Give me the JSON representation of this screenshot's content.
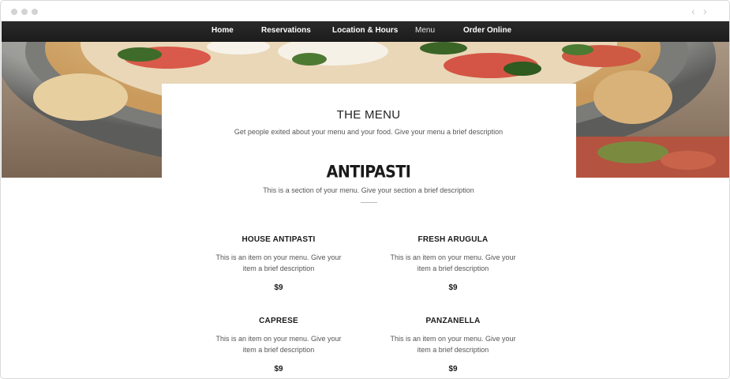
{
  "nav": {
    "items": [
      {
        "label": "Home"
      },
      {
        "label": "Reservations"
      },
      {
        "label": "Location & Hours"
      },
      {
        "label": "Menu"
      },
      {
        "label": "Order Online"
      }
    ],
    "active_index": 3
  },
  "hero": {
    "image": "pizza-photo"
  },
  "menu": {
    "title": "THE MENU",
    "description": "Get people exited about your menu and your food. Give your menu a brief description"
  },
  "section": {
    "title": "ANTIPASTI",
    "description": "This is a section of your menu. Give your section a brief description",
    "items": [
      {
        "name": "HOUSE ANTIPASTI",
        "description": "This is an item on your menu. Give your item a brief description",
        "price": "$9"
      },
      {
        "name": "FRESH ARUGULA",
        "description": "This is an item on your menu. Give your item a brief description",
        "price": "$9"
      },
      {
        "name": "CAPRESE",
        "description": "This is an item on your menu. Give your item a brief description",
        "price": "$9"
      },
      {
        "name": "PANZANELLA",
        "description": "This is an item on your menu. Give your item a brief description",
        "price": "$9"
      }
    ]
  },
  "browser": {
    "back_icon": "chevron-left-icon",
    "forward_icon": "chevron-right-icon"
  },
  "colors": {
    "nav_bg": "#1f1f1f",
    "nav_text": "#ffffff",
    "panel_bg": "#ffffff",
    "text_dark": "#1a1a1a",
    "text_muted": "#555555"
  }
}
